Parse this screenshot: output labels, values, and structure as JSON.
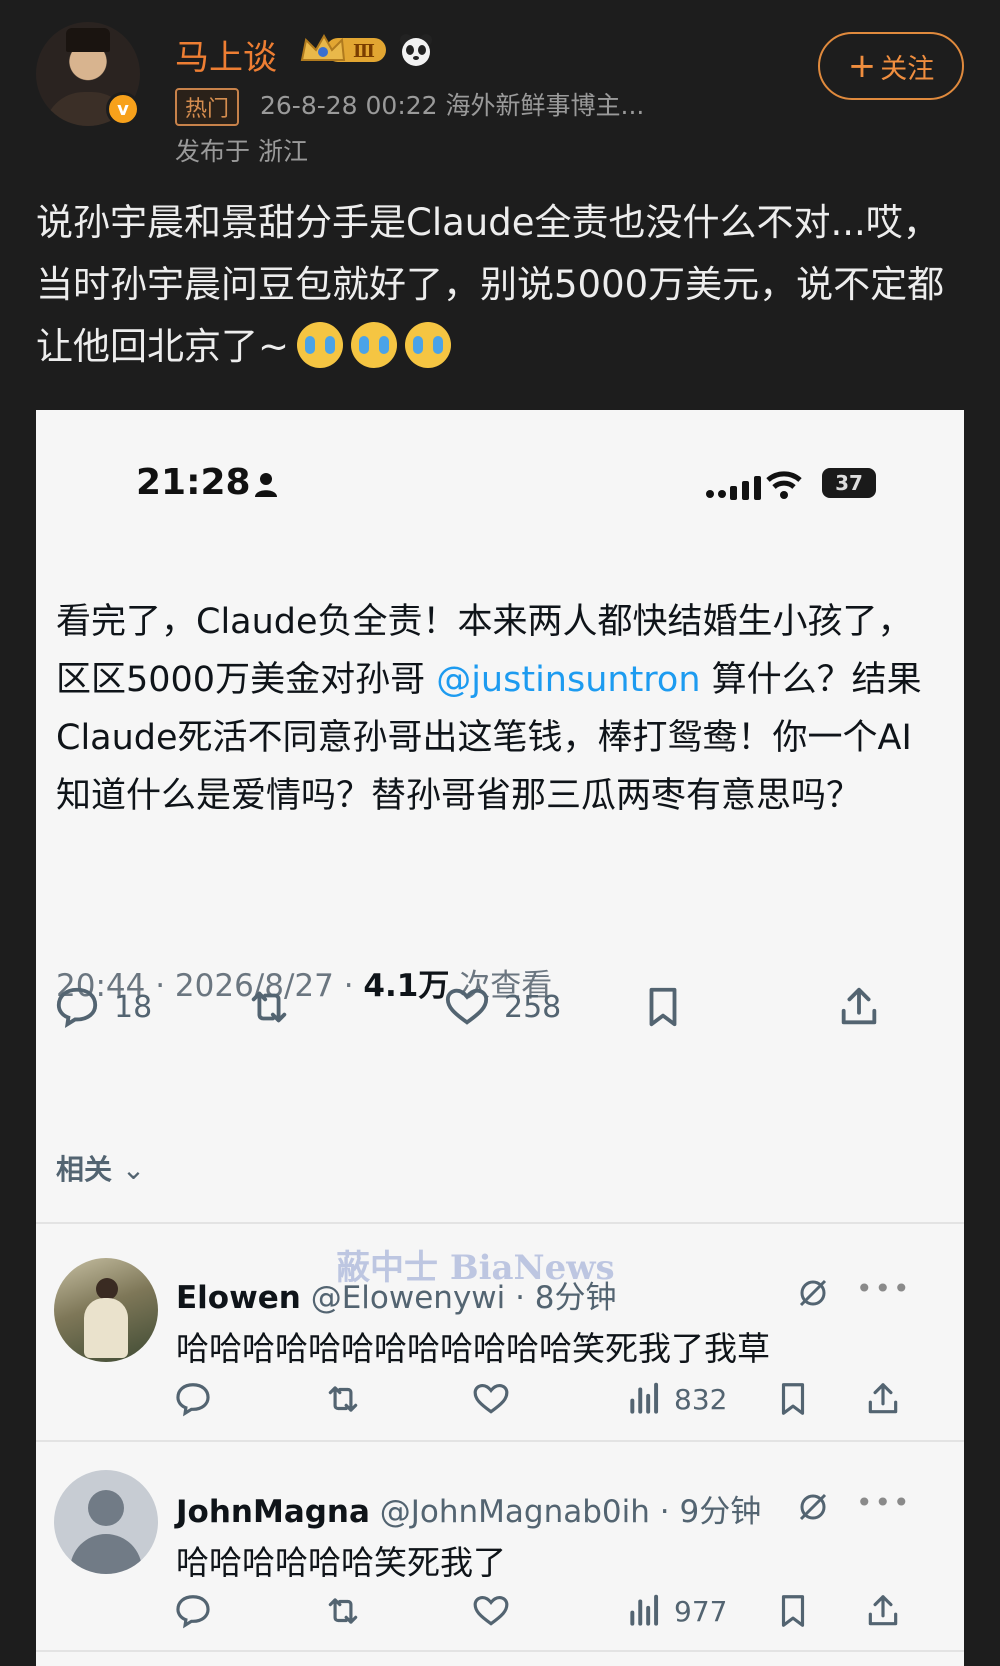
{
  "header": {
    "username": "马上谈",
    "level_badge": "Ⅲ",
    "hot_tag": "热门",
    "meta": "26-8-28 00:22  海外新鲜事博主...",
    "location": "发布于 浙江",
    "follow_label": "关注",
    "verified_mark": "v"
  },
  "post": {
    "text": "说孙宇晨和景甜分手是Claude全责也没什么不对...哎，当时孙宇晨问豆包就好了，别说5000万美元，说不定都让他回北京了~"
  },
  "screenshot": {
    "status_time": "21:28",
    "battery": "37",
    "tweet_before_mention": "看完了，Claude负全责！本来两人都快结婚生小孩了，区区5000万美金对孙哥 ",
    "mention": "@justinsuntron",
    "tweet_after_mention": " 算什么？结果Claude死活不同意孙哥出这笔钱，棒打鸳鸯！你一个AI知道什么是爱情吗？替孙哥省那三瓜两枣有意思吗？",
    "meta_time": "20:44 · 2026/8/27 · ",
    "meta_views": "4.1万",
    "meta_views_label": " 次查看",
    "replies_count": "18",
    "likes_count": "258",
    "related_label": "相关",
    "watermark": "蔽中士 BiaNews"
  },
  "replies": [
    {
      "name": "Elowen",
      "handle": " @Elowenywi · 8分钟",
      "text": "哈哈哈哈哈哈哈哈哈哈哈哈笑死我了我草",
      "views": "832"
    },
    {
      "name": "JohnMagna",
      "handle": " @JohnMagnab0ih · 9分钟",
      "text": "哈哈哈哈哈哈笑死我了",
      "views": "977"
    }
  ],
  "colors": {
    "background": "#1d1d1d",
    "accent_orange": "#ee7e33",
    "mention_blue": "#1d9bf0"
  }
}
